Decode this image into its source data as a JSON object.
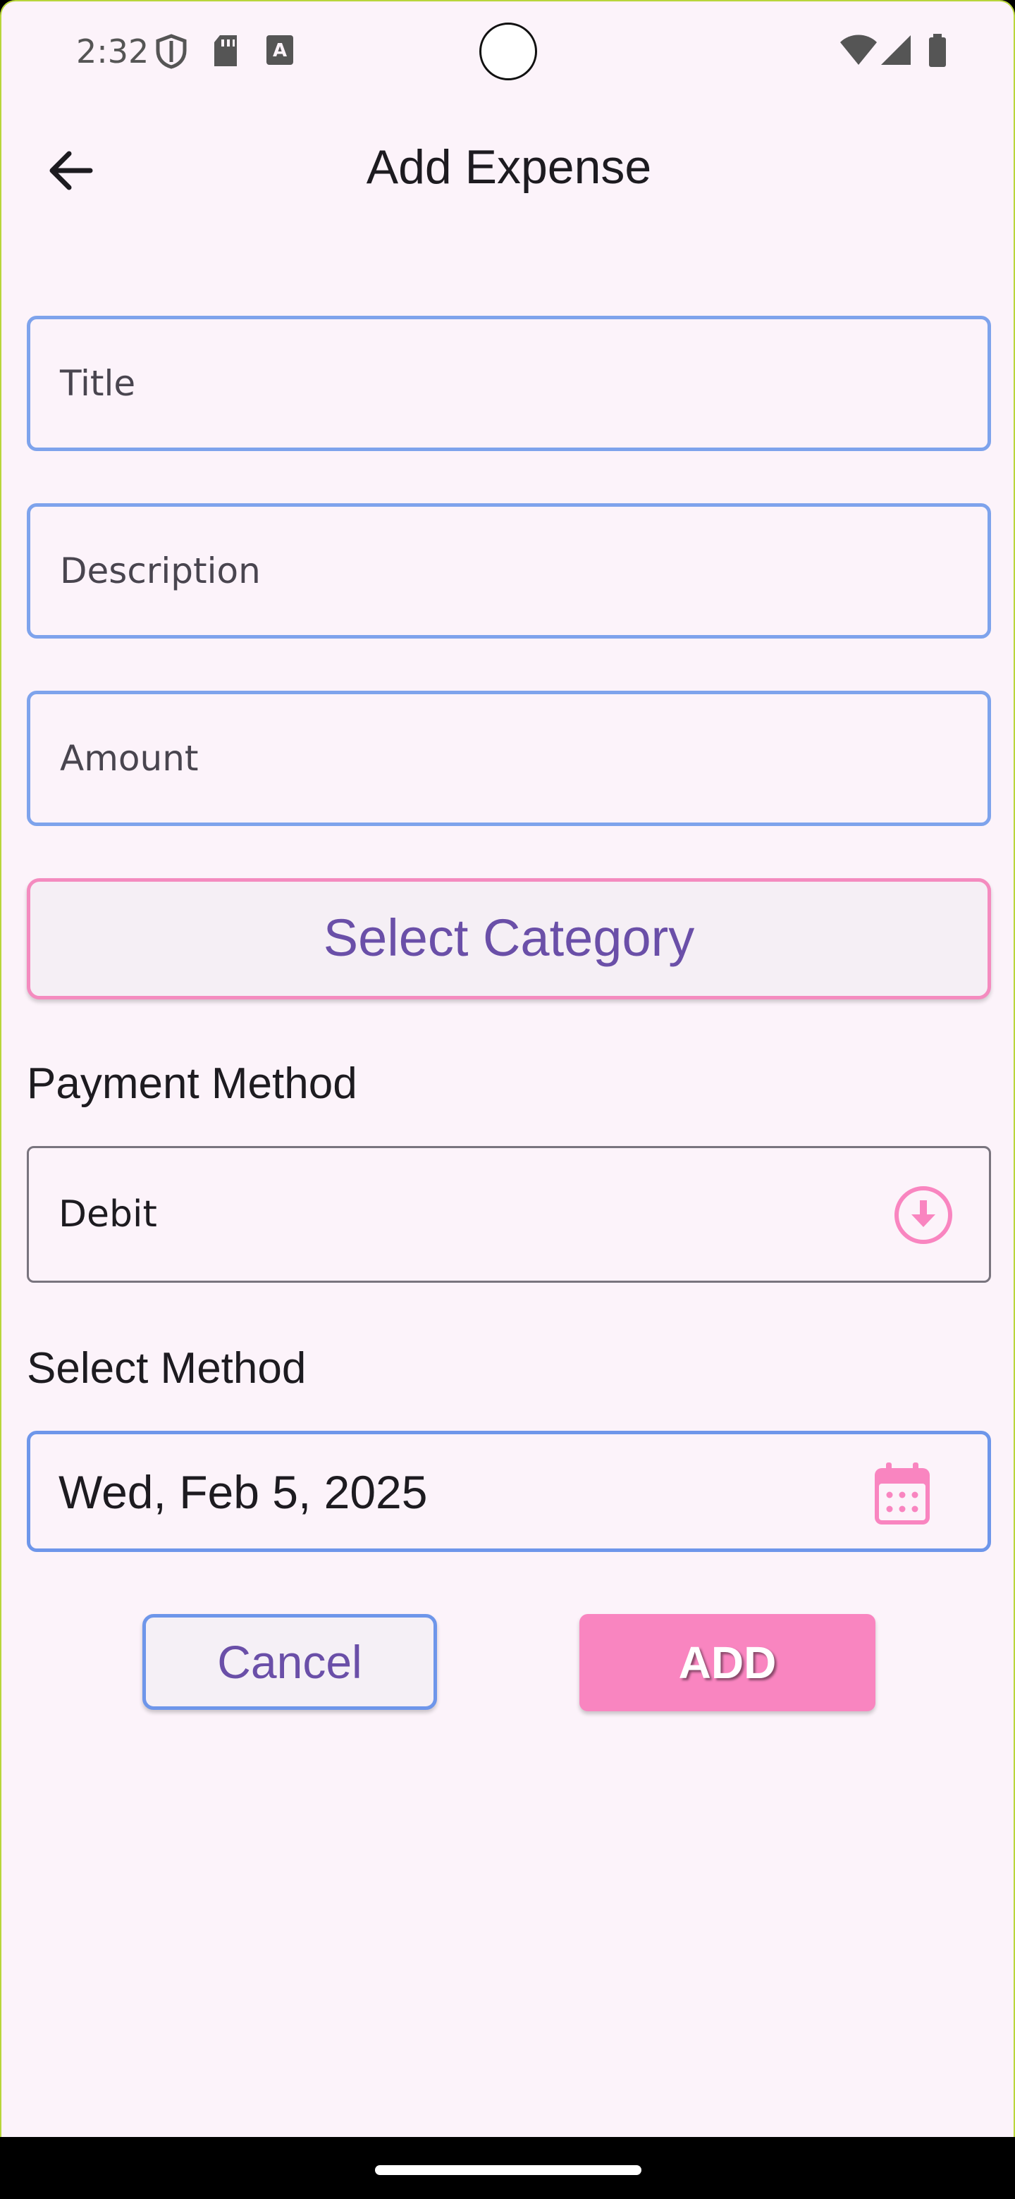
{
  "status_bar": {
    "time": "2:32",
    "left_icons": [
      "shield-icon",
      "sd-card-icon",
      "text-a-icon"
    ],
    "right_icons": [
      "wifi-icon",
      "signal-icon",
      "battery-icon"
    ]
  },
  "app_bar": {
    "title": "Add Expense",
    "back_icon": "arrow-back-icon"
  },
  "form": {
    "title_placeholder": "Title",
    "description_placeholder": "Description",
    "amount_placeholder": "Amount",
    "category_button": "Select Category",
    "payment_label": "Payment Method",
    "payment_value": "Debit",
    "method_label": "Select Method",
    "date_value": "Wed, Feb 5, 2025"
  },
  "actions": {
    "cancel": "Cancel",
    "add": "ADD"
  },
  "colors": {
    "background": "#fcf3fa",
    "field_border": "#7ea3ec",
    "accent_pink": "#f985c0",
    "accent_purple": "#6a4fa8"
  }
}
